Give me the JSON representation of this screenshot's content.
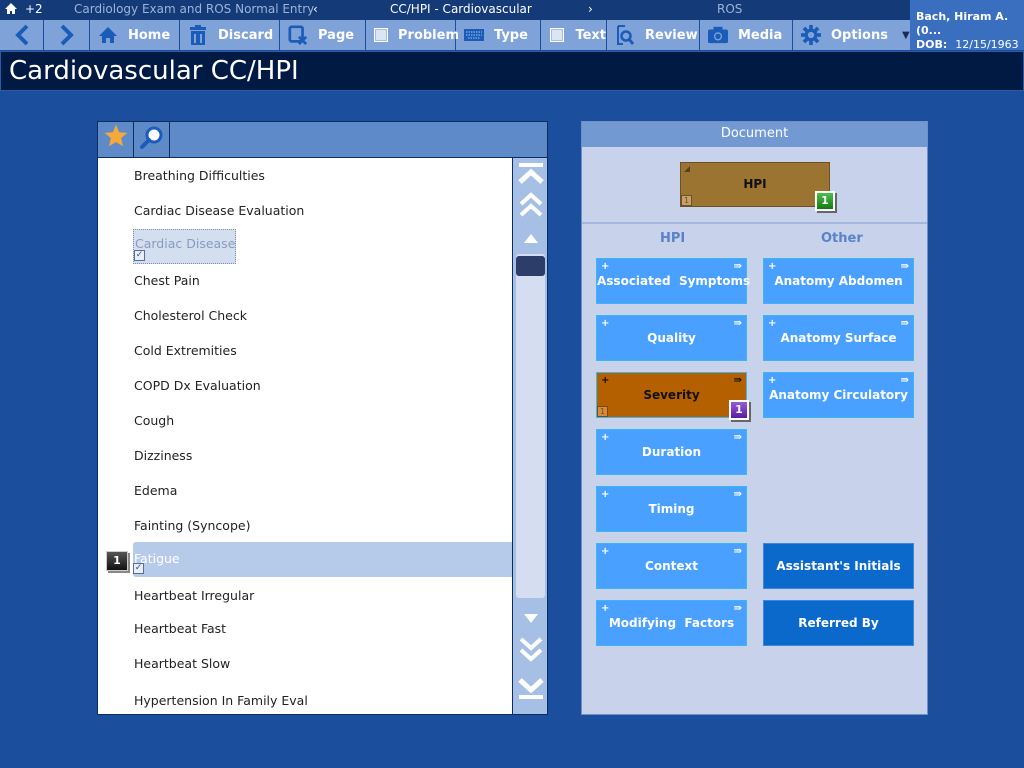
{
  "topbar": {
    "home_icon": "home-icon",
    "count": "+2",
    "prev_page": "Cardiology Exam and ROS Normal Entry",
    "left_arrow": "‹",
    "current_page": "CC/HPI - Cardiovascular",
    "right_arrow": "›",
    "next_page": "ROS"
  },
  "toolbar": {
    "back_icon": "chevron-left-icon",
    "forward_icon": "chevron-right-icon",
    "buttons": [
      {
        "label": "Home",
        "icon": "home-icon"
      },
      {
        "label": "Discard",
        "icon": "trash-icon"
      },
      {
        "label": "Page",
        "icon": "page-clear-icon"
      },
      {
        "label": "Problem",
        "icon": "checkbox-icon"
      },
      {
        "label": "Type",
        "icon": "keyboard-icon"
      },
      {
        "label": "Text",
        "icon": "checkbox-icon"
      },
      {
        "label": "Review",
        "icon": "review-search-icon"
      },
      {
        "label": "Media",
        "icon": "camera-icon"
      },
      {
        "label": "Options",
        "icon": "gear-icon"
      }
    ]
  },
  "patient": {
    "name": "Bach, Hiram A. (0...",
    "dob_label": "DOB:",
    "dob": "12/15/1963"
  },
  "page_title": "Cardiovascular CC/HPI",
  "list_panel": {
    "tabs": [
      "favorites-star-icon",
      "search-icon"
    ],
    "items": [
      {
        "label": "Breathing Difficulties",
        "state": "normal"
      },
      {
        "label": "Cardiac Disease Evaluation",
        "state": "normal"
      },
      {
        "label": "Cardiac Disease",
        "state": "checked-dotted"
      },
      {
        "label": "Chest Pain",
        "state": "normal"
      },
      {
        "label": "Cholesterol Check",
        "state": "normal"
      },
      {
        "label": "Cold Extremities",
        "state": "normal"
      },
      {
        "label": "COPD Dx Evaluation",
        "state": "normal"
      },
      {
        "label": "Cough",
        "state": "normal"
      },
      {
        "label": "Dizziness",
        "state": "normal"
      },
      {
        "label": "Edema",
        "state": "normal"
      },
      {
        "label": "Fainting (Syncope)",
        "state": "normal"
      },
      {
        "label": "Fatigue",
        "state": "selected",
        "badge": "1"
      },
      {
        "label": "Heartbeat Irregular",
        "state": "normal"
      },
      {
        "label": "Heartbeat Fast",
        "state": "normal"
      },
      {
        "label": "Heartbeat Slow",
        "state": "normal"
      },
      {
        "label": "Hypertension In Family Eval",
        "state": "normal"
      }
    ],
    "checkmark": "✓"
  },
  "document_panel": {
    "header": "Document",
    "hpi_box": {
      "label": "HPI",
      "mini_count": "1",
      "badge": "1"
    },
    "columns": {
      "hpi": "HPI",
      "other": "Other"
    },
    "hpi_buttons": [
      {
        "label": "Associated  Symptoms",
        "state": "normal"
      },
      {
        "label": "Quality",
        "state": "normal"
      },
      {
        "label": "Severity",
        "state": "active",
        "mini_count": "1",
        "badge": "1"
      },
      {
        "label": "Duration",
        "state": "normal"
      },
      {
        "label": "Timing",
        "state": "normal"
      },
      {
        "label": "Context",
        "state": "normal"
      },
      {
        "label": "Modifying  Factors",
        "state": "normal"
      }
    ],
    "other_buttons": [
      {
        "label": "Anatomy Abdomen",
        "state": "normal"
      },
      {
        "label": "Anatomy Surface",
        "state": "normal"
      },
      {
        "label": "Anatomy Circulatory",
        "state": "normal"
      },
      {
        "label": "Assistant's Initials",
        "state": "dark"
      },
      {
        "label": "Referred By",
        "state": "dark"
      }
    ],
    "plus_glyph": "+",
    "arrow_glyph": "⇛"
  },
  "colors": {
    "background": "#1b4f9e",
    "toolbar": "#7fa3d8",
    "title_bar": "#001a44",
    "chip": "#4aa0ff",
    "chip_active": "#b56000",
    "chip_dark": "#0b69cc",
    "hpi_box": "#9b7432"
  }
}
